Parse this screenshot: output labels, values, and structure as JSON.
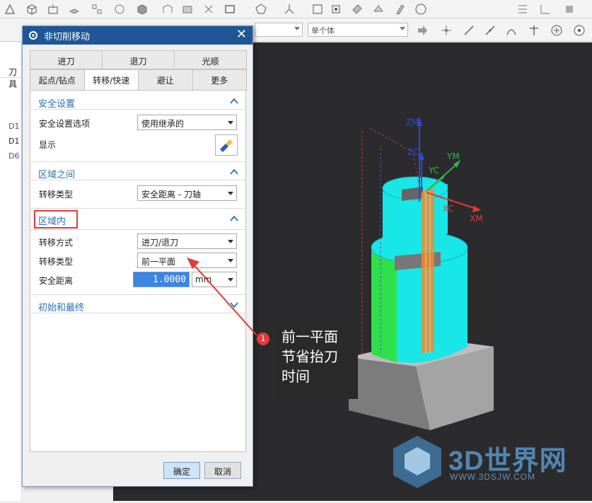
{
  "dialog": {
    "title": "非切削移动",
    "tabs_row1": [
      "进刀",
      "退刀",
      "光顺"
    ],
    "tabs_row2": [
      "起点/钻点",
      "转移/快速",
      "避让",
      "更多"
    ],
    "active_tab": "转移/快速",
    "sections": {
      "safety": {
        "header": "安全设置",
        "option_label": "安全设置选项",
        "option_value": "使用继承的",
        "display_label": "显示"
      },
      "between_regions": {
        "header": "区域之间",
        "transfer_type_label": "转移类型",
        "transfer_type_value": "安全距离 - 刀轴"
      },
      "within_region": {
        "header": "区域内",
        "transfer_method_label": "转移方式",
        "transfer_method_value": "进刀/退刀",
        "transfer_type_label": "转移类型",
        "transfer_type_value": "前一平面",
        "safe_distance_label": "安全距离",
        "safe_distance_value": "1.0000",
        "unit_value": "mm"
      },
      "initial_final": {
        "header": "初始和最终"
      }
    },
    "ok_label": "确定",
    "cancel_label": "取消"
  },
  "toolbar": {
    "combo_value": "单个体"
  },
  "left_panel": {
    "header": "刀具",
    "items": [
      "D1",
      "D1",
      "D6"
    ]
  },
  "annotation": {
    "badge": "1",
    "lines": [
      "前一平面",
      "节省抬刀",
      "时间"
    ]
  },
  "viewport": {
    "axis_labels": [
      "ZM",
      "ZC",
      "YM",
      "YC",
      "XC",
      "XM"
    ]
  },
  "watermark": {
    "brand": "3D世界网",
    "url": "WWW.3DSJW.COM"
  },
  "colors": {
    "title_bar": "#1f5796",
    "section_header": "#2c6fb6",
    "highlight": "#e53935",
    "field_selected": "#3d86e0",
    "viewport_bg": "#2b2b2d",
    "part_cyan": "#19e6e6",
    "part_green": "#2ee04a",
    "toolpath_orange": "#f08a2a"
  }
}
